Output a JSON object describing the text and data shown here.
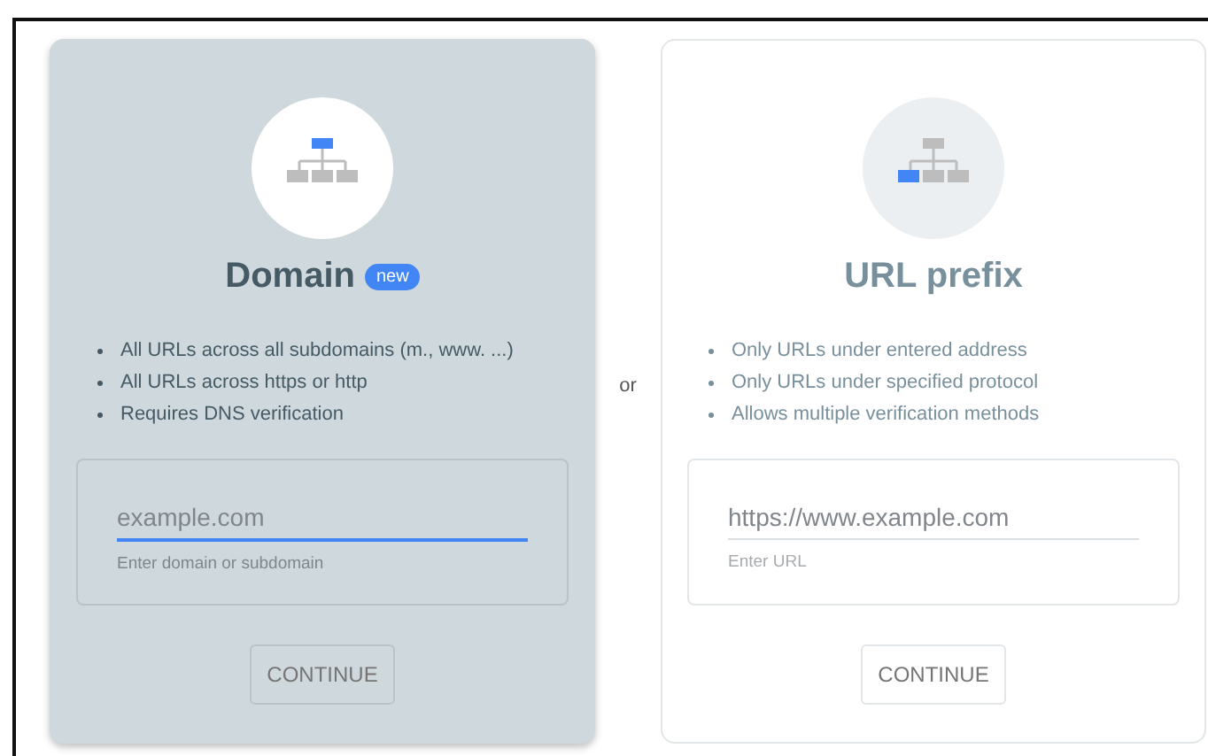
{
  "options": [
    {
      "kind": "domain",
      "title": "Domain",
      "badge": "new",
      "selected": true,
      "bullets": [
        "All URLs across all subdomains (m., www. ...)",
        "All URLs across https or http",
        "Requires DNS verification"
      ],
      "field": {
        "placeholder": "example.com",
        "helper": "Enter domain or subdomain",
        "focused": true
      },
      "button": "CONTINUE"
    },
    {
      "kind": "prefix",
      "title": "URL prefix",
      "selected": false,
      "bullets": [
        "Only URLs under entered address",
        "Only URLs under specified protocol",
        "Allows multiple verification methods"
      ],
      "field": {
        "placeholder": "https://www.example.com",
        "helper": "Enter URL",
        "focused": false
      },
      "button": "CONTINUE"
    }
  ],
  "separator": "or"
}
